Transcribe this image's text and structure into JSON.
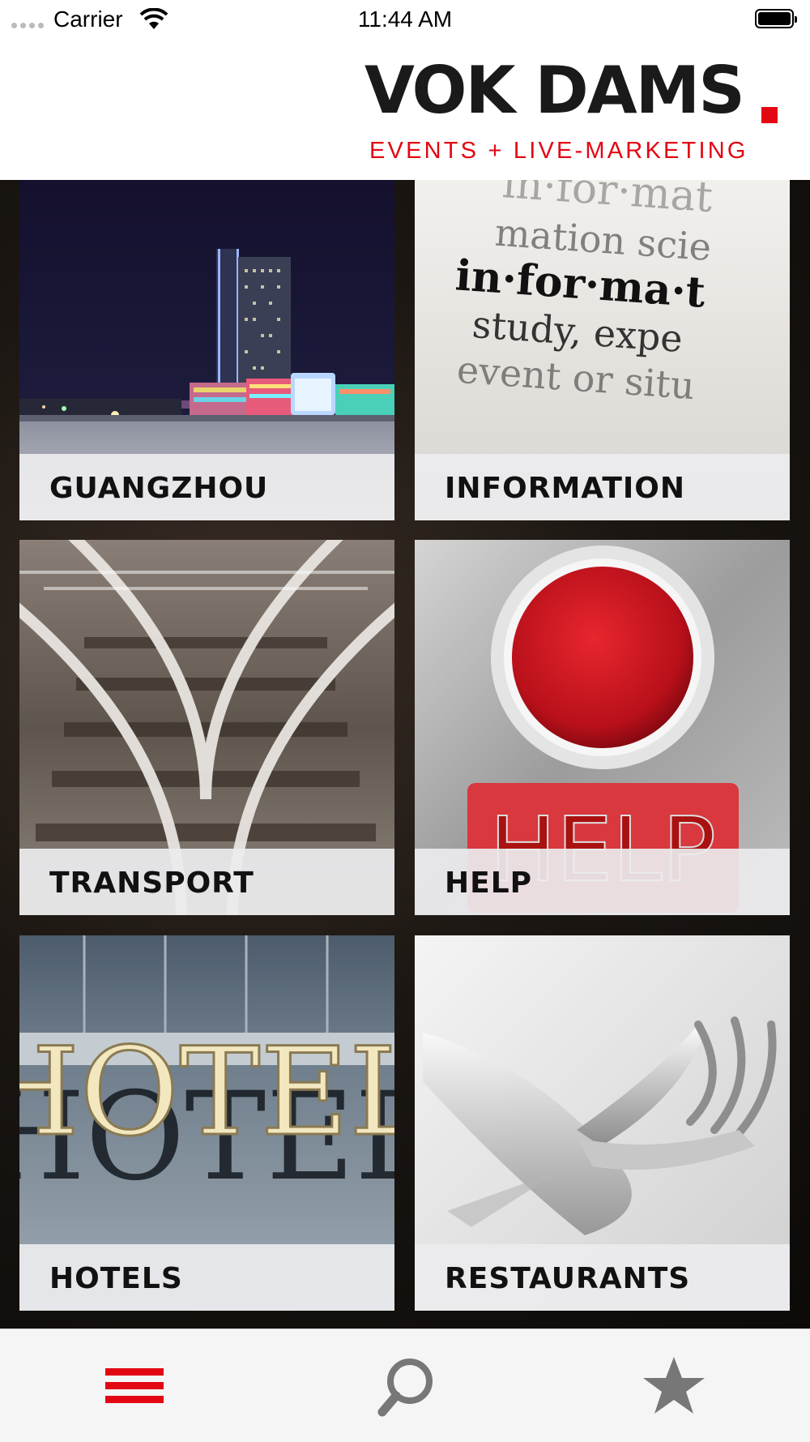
{
  "status_bar": {
    "carrier": "Carrier",
    "time": "11:44 AM"
  },
  "header": {
    "logo_main": "VOK DAMS",
    "logo_tagline": "EVENTS + LIVE-MARKETING",
    "brand_color": "#e30613"
  },
  "tiles": [
    {
      "label": "GUANGZHOU"
    },
    {
      "label": "INFORMATION"
    },
    {
      "label": "TRANSPORT"
    },
    {
      "label": "HELP"
    },
    {
      "label": "HOTELS"
    },
    {
      "label": "RESTAURANTS"
    }
  ],
  "photo_text": {
    "information_lines": [
      "in·for·mat",
      "mation scie",
      "in·for·ma·t",
      "study, expe",
      "event or situ"
    ],
    "help_sign": "HELP",
    "hotel_sign": "HOTEL"
  },
  "tab_bar": {
    "items": [
      {
        "icon": "menu-icon",
        "active": true
      },
      {
        "icon": "search-icon",
        "active": false
      },
      {
        "icon": "star-icon",
        "active": false
      }
    ],
    "active_color": "#e30613",
    "inactive_color": "#777777"
  }
}
